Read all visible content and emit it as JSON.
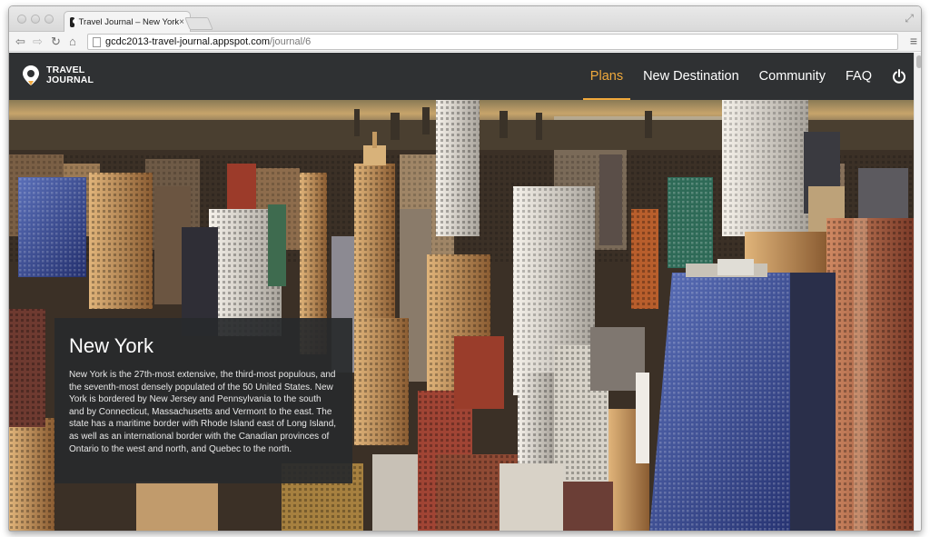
{
  "browser": {
    "tab_title": "Travel Journal – New York",
    "tab_close": "×",
    "url_host": "gcdc2013-travel-journal.appspot.com",
    "url_path": "/journal/6",
    "icons": [
      "back-icon",
      "forward-icon",
      "reload-icon",
      "home-icon",
      "page-icon",
      "menu-icon",
      "expand-icon"
    ]
  },
  "site": {
    "logo_line1": "TRAVEL",
    "logo_line2": "JOURNAL",
    "nav": [
      {
        "label": "Plans",
        "active": true
      },
      {
        "label": "New Destination",
        "active": false
      },
      {
        "label": "Community",
        "active": false
      },
      {
        "label": "FAQ",
        "active": false
      }
    ],
    "accent_color": "#f0a93c",
    "navbar_color": "#2f3133"
  },
  "destination": {
    "title": "New York",
    "description": "New York is the 27th-most extensive, the third-most populous, and the seventh-most densely populated of the 50 United States. New York is bordered by New Jersey and Pennsylvania to the south and by Connecticut, Massachusetts and Vermont to the east. The state has a maritime border with Rhode Island east of Long Island, as well as an international border with the Canadian provinces of Ontario to the west and north, and Quebec to the north."
  }
}
